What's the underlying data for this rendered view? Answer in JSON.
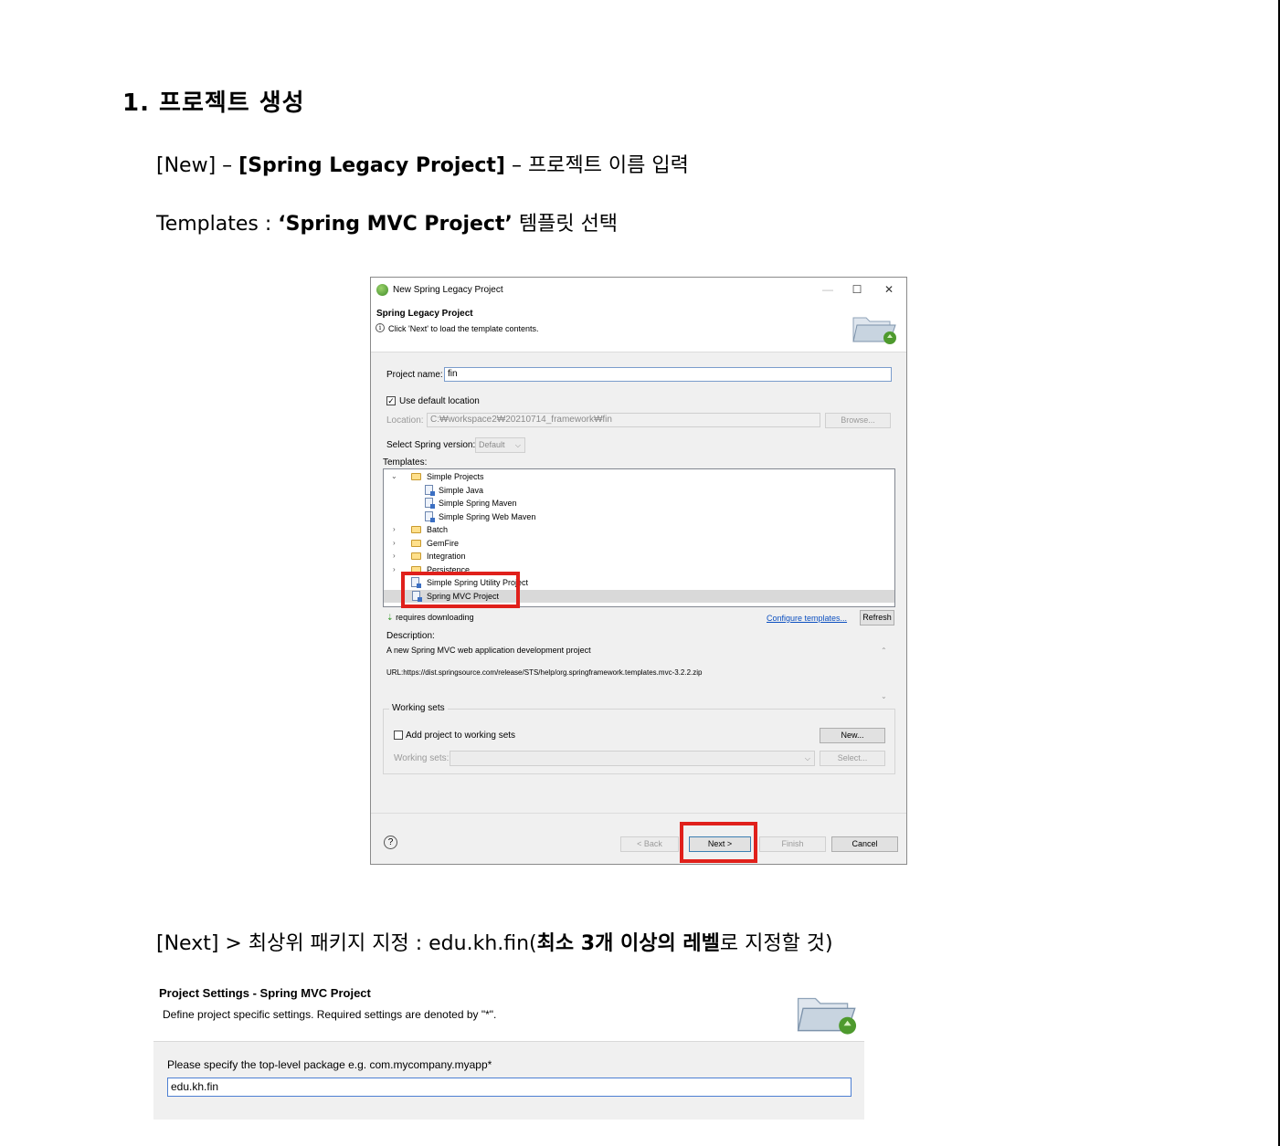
{
  "doc": {
    "heading": "1.  프로젝트  생성",
    "line1": {
      "pre": "[New] – ",
      "bold": "[Spring Legacy Project]",
      "post": " – 프로젝트  이름  입력"
    },
    "line2": {
      "pre": "Templates : ",
      "bold": "‘Spring MVC Project’",
      "post": " 템플릿  선택"
    },
    "line3": {
      "pre": "[Next] > 최상위  패키지  지정 : edu.kh.fin(",
      "bold": "최소  3개  이상의  레벨",
      "post": "로  지정할  것)"
    }
  },
  "dialog": {
    "window_title": "New Spring Legacy Project",
    "minimize": "—",
    "maximize": "☐",
    "close": "✕",
    "header_title": "Spring Legacy Project",
    "header_info": "i",
    "header_message": "Click 'Next' to load the template contents.",
    "project_name_label": "Project name:",
    "project_name_value": "fin",
    "use_default_location_label": "Use default location",
    "use_default_location_checked": true,
    "location_label": "Location:",
    "location_value": "C:₩workspace2₩20210714_framework₩fin",
    "browse_button": "Browse...",
    "spring_version_label": "Select Spring version:",
    "spring_version_value": "Default",
    "templates_label": "Templates:",
    "tree": [
      {
        "label": "Simple Projects",
        "kind": "folder",
        "level": 0,
        "expanded": true
      },
      {
        "label": "Simple Java",
        "kind": "file",
        "level": 1
      },
      {
        "label": "Simple Spring Maven",
        "kind": "file",
        "level": 1
      },
      {
        "label": "Simple Spring Web Maven",
        "kind": "file",
        "level": 1
      },
      {
        "label": "Batch",
        "kind": "folder",
        "level": 0,
        "expanded": false
      },
      {
        "label": "GemFire",
        "kind": "folder",
        "level": 0,
        "expanded": false
      },
      {
        "label": "Integration",
        "kind": "folder",
        "level": 0,
        "expanded": false
      },
      {
        "label": "Persistence",
        "kind": "folder",
        "level": 0,
        "expanded": false
      },
      {
        "label": "Simple Spring Utility Project",
        "kind": "file",
        "level": 0
      },
      {
        "label": "Spring MVC Project",
        "kind": "file",
        "level": 0,
        "selected": true
      }
    ],
    "requires_downloading": "requires downloading",
    "configure_templates_link": "Configure templates...",
    "refresh_button": "Refresh",
    "description_label": "Description:",
    "description_text": "A new Spring MVC web application development project",
    "description_url": "URL:https://dist.springsource.com/release/STS/help/org.springframework.templates.mvc-3.2.2.zip",
    "working_sets_group": "Working sets",
    "add_to_working_sets_label": "Add project to working sets",
    "add_to_working_sets_checked": false,
    "new_button": "New...",
    "working_sets_label": "Working sets:",
    "select_button": "Select...",
    "help_icon": "?",
    "back_button": "< Back",
    "next_button": "Next >",
    "finish_button": "Finish",
    "cancel_button": "Cancel"
  },
  "project_settings": {
    "title": "Project Settings - Spring MVC Project",
    "subtitle": "Define project specific settings. Required settings are denoted by \"*\".",
    "package_label": "Please specify the top-level package e.g. com.mycompany.myapp*",
    "package_value": "edu.kh.fin"
  },
  "colors": {
    "highlight": "#e0201b",
    "link": "#0b4fc0",
    "dialog_bg": "#f0f0f0"
  }
}
